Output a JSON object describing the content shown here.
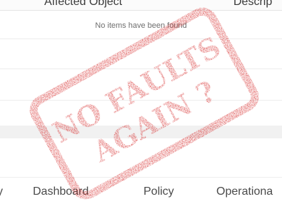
{
  "table": {
    "headers": {
      "affected_object": "Affected Object",
      "description": "Descrip"
    },
    "empty_message": "No items have been found"
  },
  "bottom_nav": {
    "items": [
      "y",
      "Dashboard",
      "Policy",
      "Operationa"
    ]
  },
  "stamp": {
    "line1": "NO FAULTS",
    "line2": "AGAIN ?",
    "color": "#d62a2a"
  }
}
